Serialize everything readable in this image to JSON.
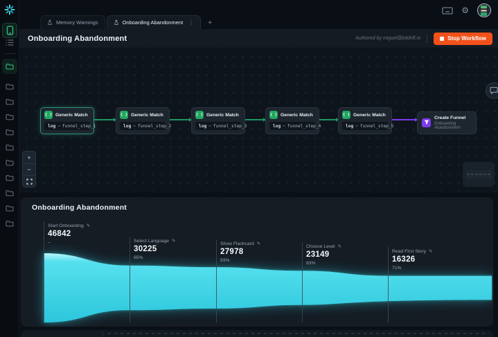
{
  "topbar": {
    "tabs": [
      {
        "label": "Memory Warnings",
        "active": false
      },
      {
        "label": "Onboarding Abandonment",
        "active": true
      }
    ],
    "new_tab_label": "+"
  },
  "header": {
    "title": "Onboarding Abandonment",
    "authored_by": "Authored by miguel@bitdrift.io",
    "stop_button_label": "Stop Workflow"
  },
  "workflow": {
    "nodes": [
      {
        "title": "Generic Match",
        "key": "log",
        "op": "=",
        "value": "funnel_step_1",
        "selected": true
      },
      {
        "title": "Generic Match",
        "key": "log",
        "op": "=",
        "value": "funnel_step_2",
        "selected": false
      },
      {
        "title": "Generic Match",
        "key": "log",
        "op": "=",
        "value": "funnel_step_3",
        "selected": false
      },
      {
        "title": "Generic Match",
        "key": "log",
        "op": "=",
        "value": "funnel_step_4",
        "selected": false
      },
      {
        "title": "Generic Match",
        "key": "log",
        "op": "=",
        "value": "funnel_step_5",
        "selected": false
      }
    ],
    "funnel_node": {
      "title": "Create Funnel",
      "subtitle": "Onboarding Abandonment"
    }
  },
  "chart_data": {
    "type": "area",
    "variant": "horizontal-funnel",
    "title": "Onboarding Abandonment",
    "steps": [
      {
        "label": "Start Onboarding",
        "value": 46842,
        "pct": "–"
      },
      {
        "label": "Select Language",
        "value": 30225,
        "pct": "65%"
      },
      {
        "label": "Show Flashcard",
        "value": 27978,
        "pct": "93%"
      },
      {
        "label": "Choose Level",
        "value": 23149,
        "pct": "83%"
      },
      {
        "label": "Read First Story",
        "value": 16326,
        "pct": "71%"
      }
    ],
    "fill_color": "#35d3e4",
    "accent_green": "#23a562",
    "accent_purple": "#7c3aed",
    "stop_orange": "#f2511b"
  },
  "icons": {
    "kebab": "⋮",
    "gear": "⚙",
    "plus": "+",
    "minus": "−",
    "pencil": "✎",
    "braces": "{ }"
  }
}
